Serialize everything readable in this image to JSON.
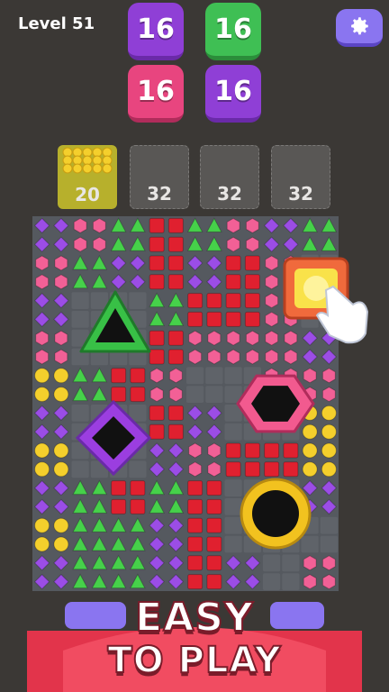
{
  "header": {
    "level": "Level 51"
  },
  "top_tiles": [
    {
      "label": "16",
      "color": "#8f3fd6"
    },
    {
      "label": "16",
      "color": "#3fbf54"
    },
    {
      "label": "16",
      "color": "#e8457f"
    },
    {
      "label": "16",
      "color": "#8f3fd6"
    }
  ],
  "slots": [
    {
      "label": "20",
      "filled": true,
      "gem": "yellow"
    },
    {
      "label": "32",
      "filled": false
    },
    {
      "label": "32",
      "filled": false
    },
    {
      "label": "32",
      "filled": false
    }
  ],
  "board": {
    "rows": [
      "PPHHTTRRTTHHPPTT",
      "PPHHTTRRTTHHPPTT",
      "HHTTPPRRPPRRHHEE",
      "HHTTPPRRPPRRHHEE",
      "PPEEEETTRRRRHHEE",
      "PPEEEETTRRRRHHEE",
      "HHEEEERRHHHHHHPP",
      "HHEEEERRHHHHHHPP",
      "YYTTRRHHEEEEHHHH",
      "YYTTRRHHEEEEHHHH",
      "PPEEEERRPPEEEEYY",
      "PPEEEERRPPEEEEYY",
      "YYEEEEPPHHRRRRYY",
      "YYEEEEPPHHRRRRYY",
      "PPTTRRTTRREEEEPP",
      "PPTTRRTTRREEEEPP",
      "YYTTTTPPRREEEEEE",
      "YYTTTTPPRREEEEEE",
      "PPTTTTPPRRPPEEHH",
      "PPTTTTPPRRPPEEHH"
    ],
    "holes": [
      {
        "shape": "triangle",
        "color": "#38c046"
      },
      {
        "shape": "hexagon",
        "color": "#f25a8f"
      },
      {
        "shape": "diamond",
        "color": "#9b3ee0"
      },
      {
        "shape": "circle",
        "color": "#f2c21f"
      },
      {
        "shape": "square",
        "color": "#f06a3c",
        "selected": true
      }
    ]
  },
  "gem_colors": {
    "P": "#9b4de6",
    "H": "#f26096",
    "T": "#46d14a",
    "R": "#e0202f",
    "Y": "#f4cf2c"
  },
  "banner": {
    "line1": "EASY",
    "line2": "TO PLAY",
    "color": "#e2344b"
  },
  "icons": {
    "settings": "gear-icon",
    "pointer": "hand-pointer-icon"
  }
}
